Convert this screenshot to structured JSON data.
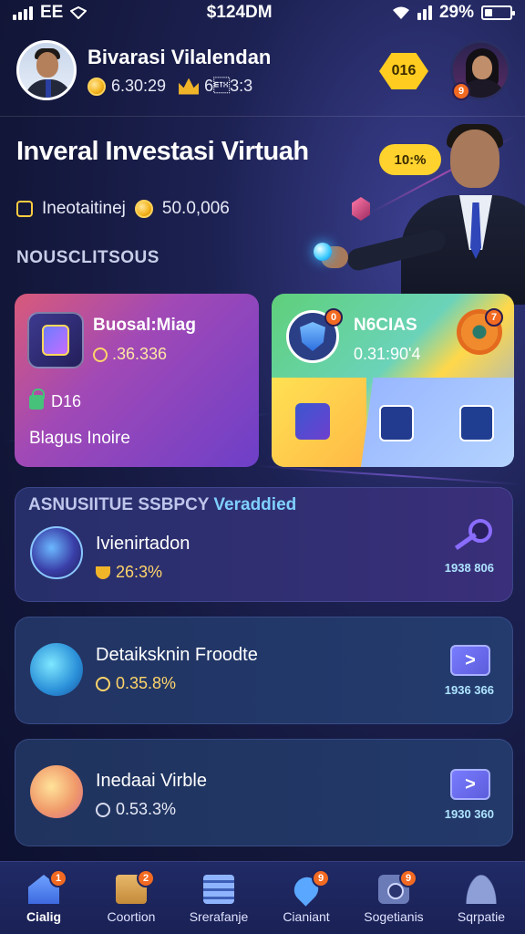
{
  "status_bar": {
    "carrier": "EE",
    "time": "$124DM",
    "battery": "29%",
    "battery_level": 0.29
  },
  "header": {
    "user_name": "Bivarasi Vilalendan",
    "coins": "6.30:29",
    "rank_value": "6\u00033:3",
    "level_badge": "016",
    "right_avatar_badge": "9"
  },
  "hero": {
    "title": "Inveral Investasi Virtuah",
    "pill": "10:%",
    "label": "Ineotaitinej",
    "amount": "50.0,006"
  },
  "section_label": "NOUSCLITSOUS",
  "cards": {
    "left": {
      "title": "Buosal:Miag",
      "value": ".36.336",
      "lock_text": "D16",
      "footer": "Blagus Inoire"
    },
    "right": {
      "title": "N6CIAS",
      "value": "0.31:90'4",
      "badge_shield": "0",
      "badge_gear": "7"
    }
  },
  "list": [
    {
      "header": "ASNUSIITUE SSBPCY",
      "header_accent": "Veraddied",
      "title": "Ivienirtadon",
      "value": "26:3%",
      "meta": "1938 806"
    },
    {
      "title": "Detaiksknin Froodte",
      "value": "0.35.8%",
      "meta": "1936 366",
      "button": ">"
    },
    {
      "title": "Inedaai Virble",
      "value": "0.53.3%",
      "meta": "1930 360",
      "button": ">"
    }
  ],
  "bottom_nav": [
    {
      "label": "Cialig",
      "icon": "home-icon",
      "badge": "1",
      "active": true
    },
    {
      "label": "Coortion",
      "icon": "box-icon",
      "badge": "2",
      "active": false
    },
    {
      "label": "Srerafanje",
      "icon": "stack-icon",
      "badge": "",
      "active": false
    },
    {
      "label": "Cianiant",
      "icon": "pin-icon",
      "badge": "9",
      "active": false
    },
    {
      "label": "Sogetianis",
      "icon": "camera-icon",
      "badge": "9",
      "active": false
    },
    {
      "label": "Sqrpatie",
      "icon": "user-icon",
      "badge": "",
      "active": false
    }
  ],
  "colors": {
    "accent_yellow": "#ffcc1f",
    "badge_orange": "#f26a21",
    "background": "#121638"
  }
}
